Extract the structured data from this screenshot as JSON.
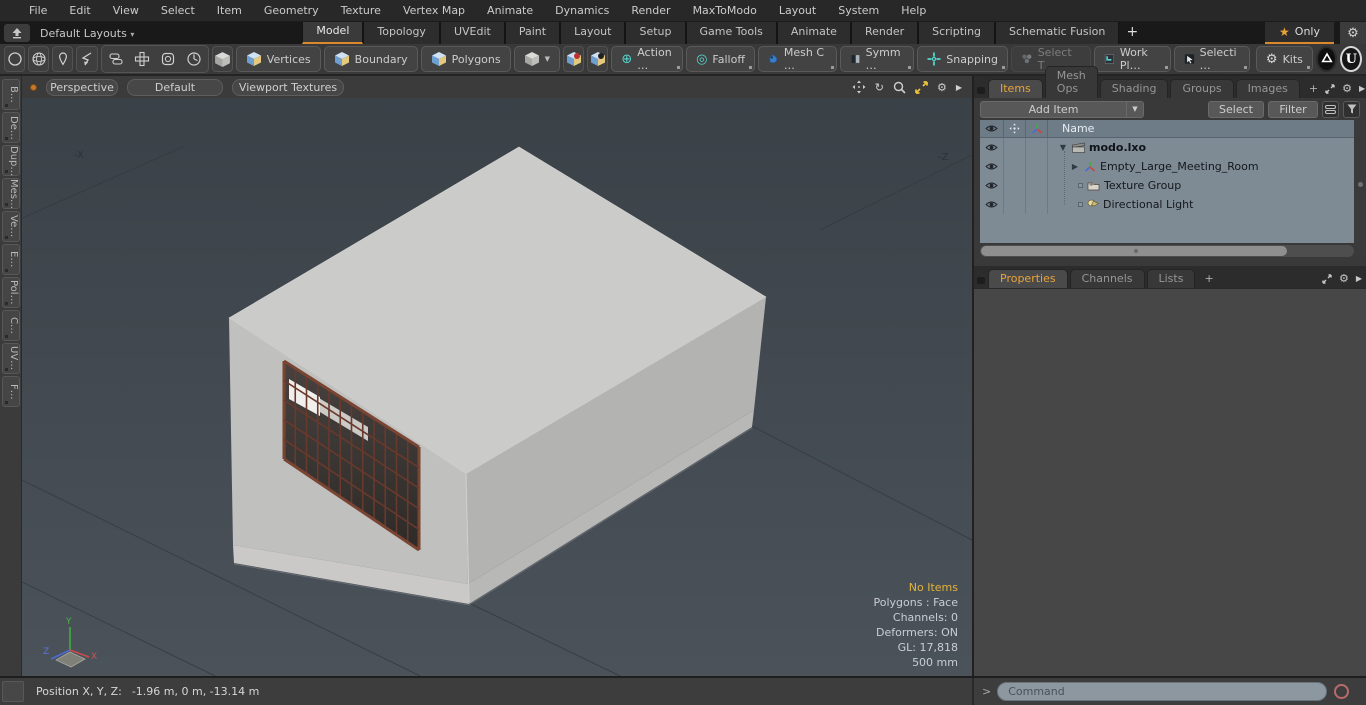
{
  "menubar": {
    "items": [
      "File",
      "Edit",
      "View",
      "Select",
      "Item",
      "Geometry",
      "Texture",
      "Vertex Map",
      "Animate",
      "Dynamics",
      "Render",
      "MaxToModo",
      "Layout",
      "System",
      "Help"
    ]
  },
  "layoutbar": {
    "switcher": "Default Layouts",
    "tabs": [
      "Model",
      "Topology",
      "UVEdit",
      "Paint",
      "Layout",
      "Setup",
      "Game Tools",
      "Animate",
      "Render",
      "Scripting",
      "Schematic Fusion"
    ],
    "add_tab": "+",
    "only_label": "Only"
  },
  "toolbar": {
    "vertices": "Vertices",
    "boundary": "Boundary",
    "polygons": "Polygons",
    "action": "Action  …",
    "falloff": "Falloff",
    "mesh_constraint": "Mesh C …",
    "symmetry": "Symm …",
    "snapping": "Snapping",
    "select_through": "Select T…",
    "work_plane": "Work Pl…",
    "selection": "Selecti …",
    "kits": "Kits"
  },
  "side_tabs": {
    "items": [
      "B…",
      "De…",
      "Dup…",
      "Mes…",
      "Ve…",
      "E…",
      "Pol…",
      "C…",
      "UV…",
      "F…"
    ]
  },
  "viewport": {
    "mode": "Perspective",
    "style": "Default",
    "textures": "Viewport Textures",
    "axis": {
      "x": "X",
      "y": "Y",
      "z": "Z",
      "neg_x": "-X",
      "neg_z": "-Z"
    },
    "stats": {
      "selection": "No Items",
      "lines": [
        "Polygons : Face",
        "Channels: 0",
        "Deformers: ON",
        "GL: 17,818",
        "500 mm"
      ]
    }
  },
  "items_panel": {
    "tabs": [
      "Items",
      "Mesh Ops",
      "Shading",
      "Groups",
      "Images"
    ],
    "add_tab": "+",
    "add_item": "Add Item",
    "select": "Select",
    "filter": "Filter",
    "name_column": "Name",
    "tree": [
      {
        "label": "modo.lxo"
      },
      {
        "label": "Empty_Large_Meeting_Room"
      },
      {
        "label": "Texture Group"
      },
      {
        "label": "Directional Light"
      }
    ]
  },
  "properties_panel": {
    "tabs": [
      "Properties",
      "Channels",
      "Lists"
    ],
    "add_tab": "+"
  },
  "statusbar": {
    "position_label": "Position X, Y, Z:",
    "position_value": "-1.96 m, 0 m, -13.14 m",
    "prompt": ">",
    "command_placeholder": "Command"
  },
  "icons": {
    "star": "★",
    "gear": "⚙",
    "dropdown_arrow": "▼",
    "panel_arrow": "▶",
    "rotate_arrow": "↻",
    "tree_expanded": "▼",
    "tree_collapsed": "▶",
    "action_center": "⊕",
    "falloff": "◎",
    "caret_down": "▾",
    "plus": "+"
  },
  "colors": {
    "accent_orange": "#e8a33d",
    "tool_teal": "#54d6cd",
    "viewport_bg": "#454c52",
    "list_bg": "#7e8a94",
    "window_frame_brown": "#74412f",
    "no_items_yellow": "#e3b33c"
  }
}
